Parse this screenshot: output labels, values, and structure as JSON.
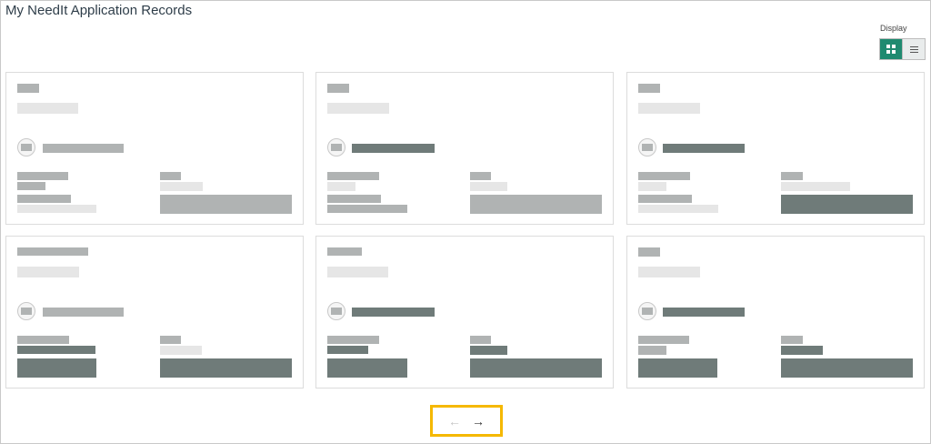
{
  "page": {
    "title": "My NeedIt Application Records"
  },
  "display": {
    "label": "Display",
    "grid_view_icon": "grid-view-icon",
    "list_view_icon": "list-view-icon",
    "active_view": "grid"
  },
  "pagination": {
    "prev_glyph": "←",
    "next_glyph": "→",
    "prev_enabled": false,
    "next_enabled": true
  },
  "colors": {
    "accent": "#1f8a70",
    "highlight": "#f5b800",
    "placeholder_gray": "#b0b3b3",
    "placeholder_light": "#e6e6e6",
    "placeholder_dark": "#6f7b79"
  },
  "cards": [
    {
      "loading": true
    },
    {
      "loading": true
    },
    {
      "loading": true
    },
    {
      "loading": true
    },
    {
      "loading": true
    },
    {
      "loading": true
    }
  ]
}
